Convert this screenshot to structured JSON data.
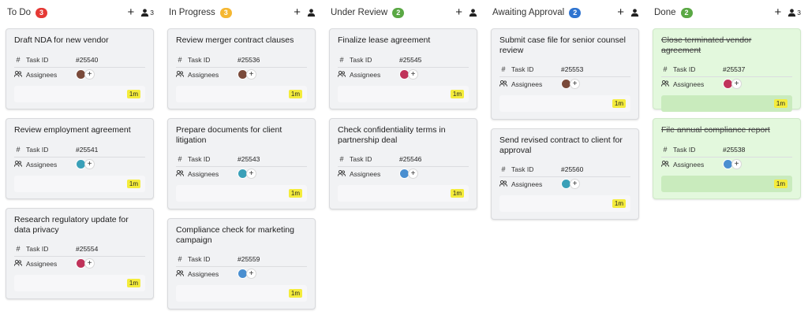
{
  "columns": [
    {
      "title": "To Do",
      "count": "3",
      "badge_color": "#e53935",
      "user_count": "3",
      "cards": [
        {
          "title": "Draft NDA for new vendor",
          "task_id_label": "Task ID",
          "task_id": "#25540",
          "assignees_label": "Assignees",
          "avatar_color": "#7a4a3a",
          "time": "1m"
        },
        {
          "title": "Review employment agreement",
          "task_id_label": "Task ID",
          "task_id": "#25541",
          "assignees_label": "Assignees",
          "avatar_color": "#3aa0b8",
          "time": "1m"
        },
        {
          "title": "Research regulatory update for data privacy",
          "task_id_label": "Task ID",
          "task_id": "#25554",
          "assignees_label": "Assignees",
          "avatar_color": "#c0335a",
          "time": "1m"
        }
      ]
    },
    {
      "title": "In Progress",
      "count": "3",
      "badge_color": "#f5b731",
      "user_count": "",
      "cards": [
        {
          "title": "Review merger contract clauses",
          "task_id_label": "Task ID",
          "task_id": "#25536",
          "assignees_label": "Assignees",
          "avatar_color": "#7a4a3a",
          "time": "1m"
        },
        {
          "title": "Prepare documents for client litigation",
          "task_id_label": "Task ID",
          "task_id": "#25543",
          "assignees_label": "Assignees",
          "avatar_color": "#3aa0b8",
          "time": "1m"
        },
        {
          "title": "Compliance check for marketing campaign",
          "task_id_label": "Task ID",
          "task_id": "#25559",
          "assignees_label": "Assignees",
          "avatar_color": "#4a8fd0",
          "time": "1m"
        }
      ]
    },
    {
      "title": "Under Review",
      "count": "2",
      "badge_color": "#5aa844",
      "user_count": "",
      "cards": [
        {
          "title": "Finalize lease agreement",
          "task_id_label": "Task ID",
          "task_id": "#25545",
          "assignees_label": "Assignees",
          "avatar_color": "#c0335a",
          "time": "1m"
        },
        {
          "title": "Check confidentiality terms in partnership deal",
          "task_id_label": "Task ID",
          "task_id": "#25546",
          "assignees_label": "Assignees",
          "avatar_color": "#4a8fd0",
          "time": "1m"
        }
      ]
    },
    {
      "title": "Awaiting Approval",
      "count": "2",
      "badge_color": "#2f74d0",
      "user_count": "",
      "cards": [
        {
          "title": "Submit case file for senior counsel review",
          "task_id_label": "Task ID",
          "task_id": "#25553",
          "assignees_label": "Assignees",
          "avatar_color": "#7a4a3a",
          "time": "1m"
        },
        {
          "title": "Send revised contract to client for approval",
          "task_id_label": "Task ID",
          "task_id": "#25560",
          "assignees_label": "Assignees",
          "avatar_color": "#3aa0b8",
          "time": "1m"
        }
      ]
    },
    {
      "title": "Done",
      "count": "2",
      "badge_color": "#5aa844",
      "user_count": "3",
      "cards": [
        {
          "title": "Close terminated vendor agreement",
          "task_id_label": "Task ID",
          "task_id": "#25537",
          "assignees_label": "Assignees",
          "avatar_color": "#c0335a",
          "time": "1m"
        },
        {
          "title": "File annual compliance report",
          "task_id_label": "Task ID",
          "task_id": "#25538",
          "assignees_label": "Assignees",
          "avatar_color": "#4a8fd0",
          "time": "1m"
        }
      ]
    }
  ]
}
